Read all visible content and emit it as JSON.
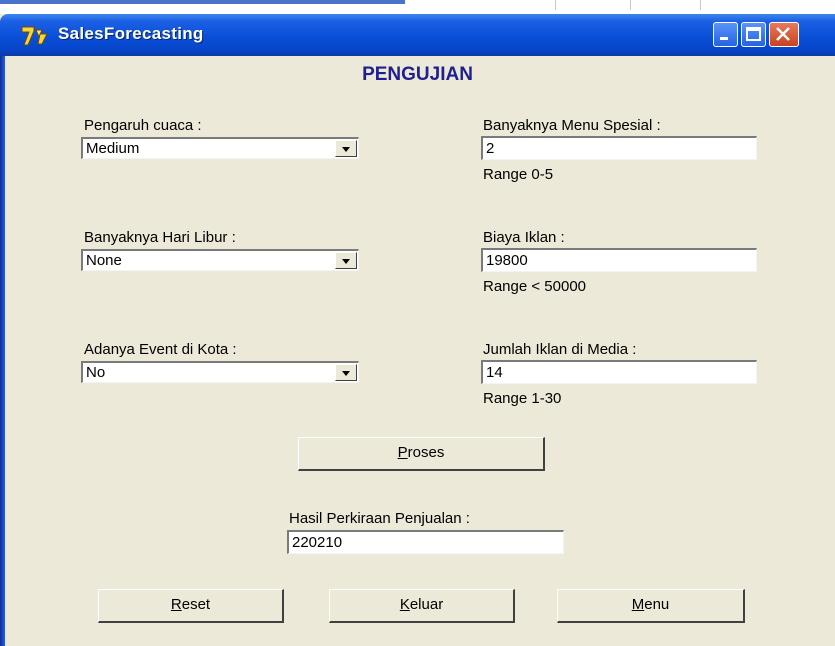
{
  "window": {
    "title": "SalesForecasting"
  },
  "form": {
    "heading": "PENGUJIAN",
    "left_fields": [
      {
        "label": "Pengaruh cuaca :",
        "value": "Medium"
      },
      {
        "label": "Banyaknya Hari Libur :",
        "value": "None"
      },
      {
        "label": "Adanya Event di Kota :",
        "value": "No"
      }
    ],
    "right_fields": [
      {
        "label": "Banyaknya Menu Spesial :",
        "value": "2",
        "hint": "Range 0-5"
      },
      {
        "label": "Biaya Iklan :",
        "value": "19800",
        "hint": "Range < 50000"
      },
      {
        "label": "Jumlah Iklan di Media :",
        "value": "14",
        "hint": "Range 1-30"
      }
    ],
    "process_button": {
      "mnemonic": "P",
      "rest": "roses"
    },
    "result": {
      "label": "Hasil Perkiraan Penjualan :",
      "value": "220210"
    },
    "buttons": [
      {
        "mnemonic": "R",
        "rest": "eset"
      },
      {
        "mnemonic": "K",
        "rest": "eluar"
      },
      {
        "mnemonic": "M",
        "rest": "enu"
      }
    ]
  }
}
